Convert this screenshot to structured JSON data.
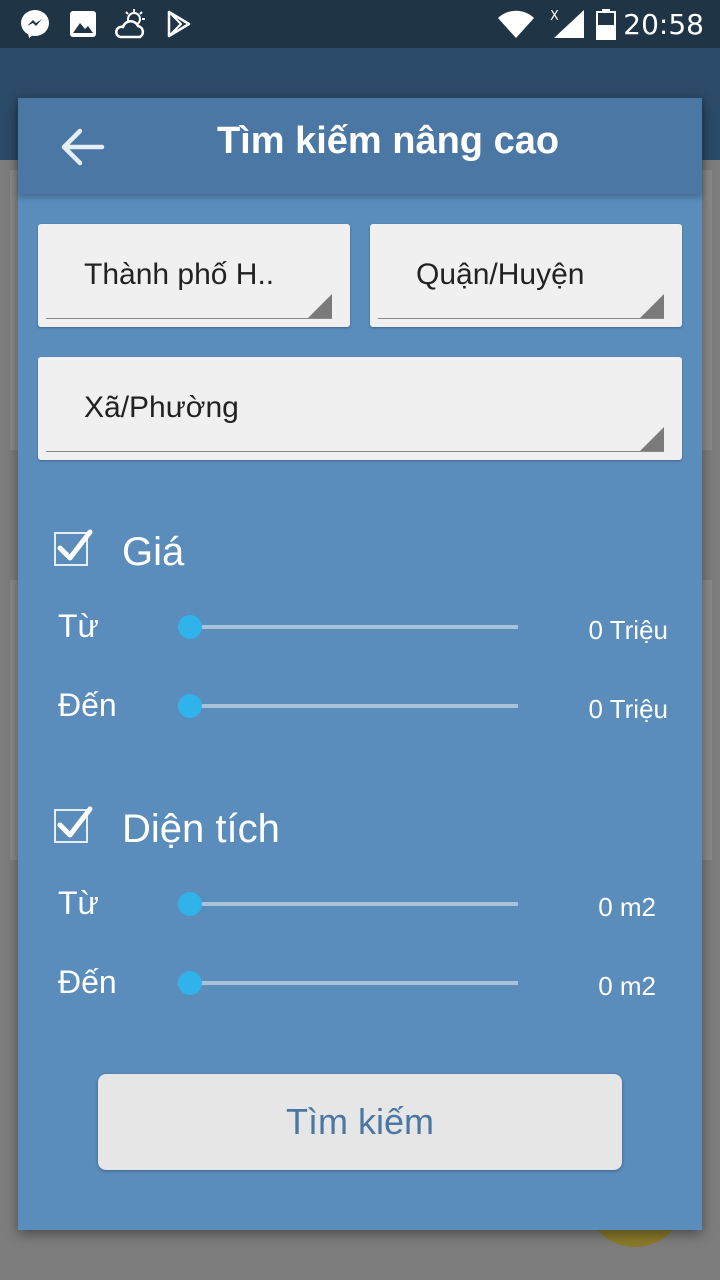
{
  "status_bar": {
    "time": "20:58",
    "icons": [
      "messenger-icon",
      "image-icon",
      "weather-icon",
      "play-store-icon",
      "wifi-icon",
      "signal-icon",
      "battery-icon"
    ]
  },
  "dialog": {
    "title": "Tìm kiếm nâng cao",
    "city_select": "Thành phố H..",
    "district_select": "Quận/Huyện",
    "ward_select": "Xã/Phường",
    "price": {
      "label": "Giá",
      "checked": true,
      "from_label": "Từ",
      "from_value": "0 Triệu",
      "to_label": "Đến",
      "to_value": "0 Triệu"
    },
    "area": {
      "label": "Diện tích",
      "checked": true,
      "from_label": "Từ",
      "from_value": "0 m2",
      "to_label": "Đến",
      "to_value": "0 m2"
    },
    "search_button": "Tìm kiếm"
  },
  "colors": {
    "dialog_bg": "#5a8cbc",
    "header_bg": "#4a77a4",
    "slider_thumb": "#2fb3ea",
    "status_bar": "#1f3445"
  }
}
